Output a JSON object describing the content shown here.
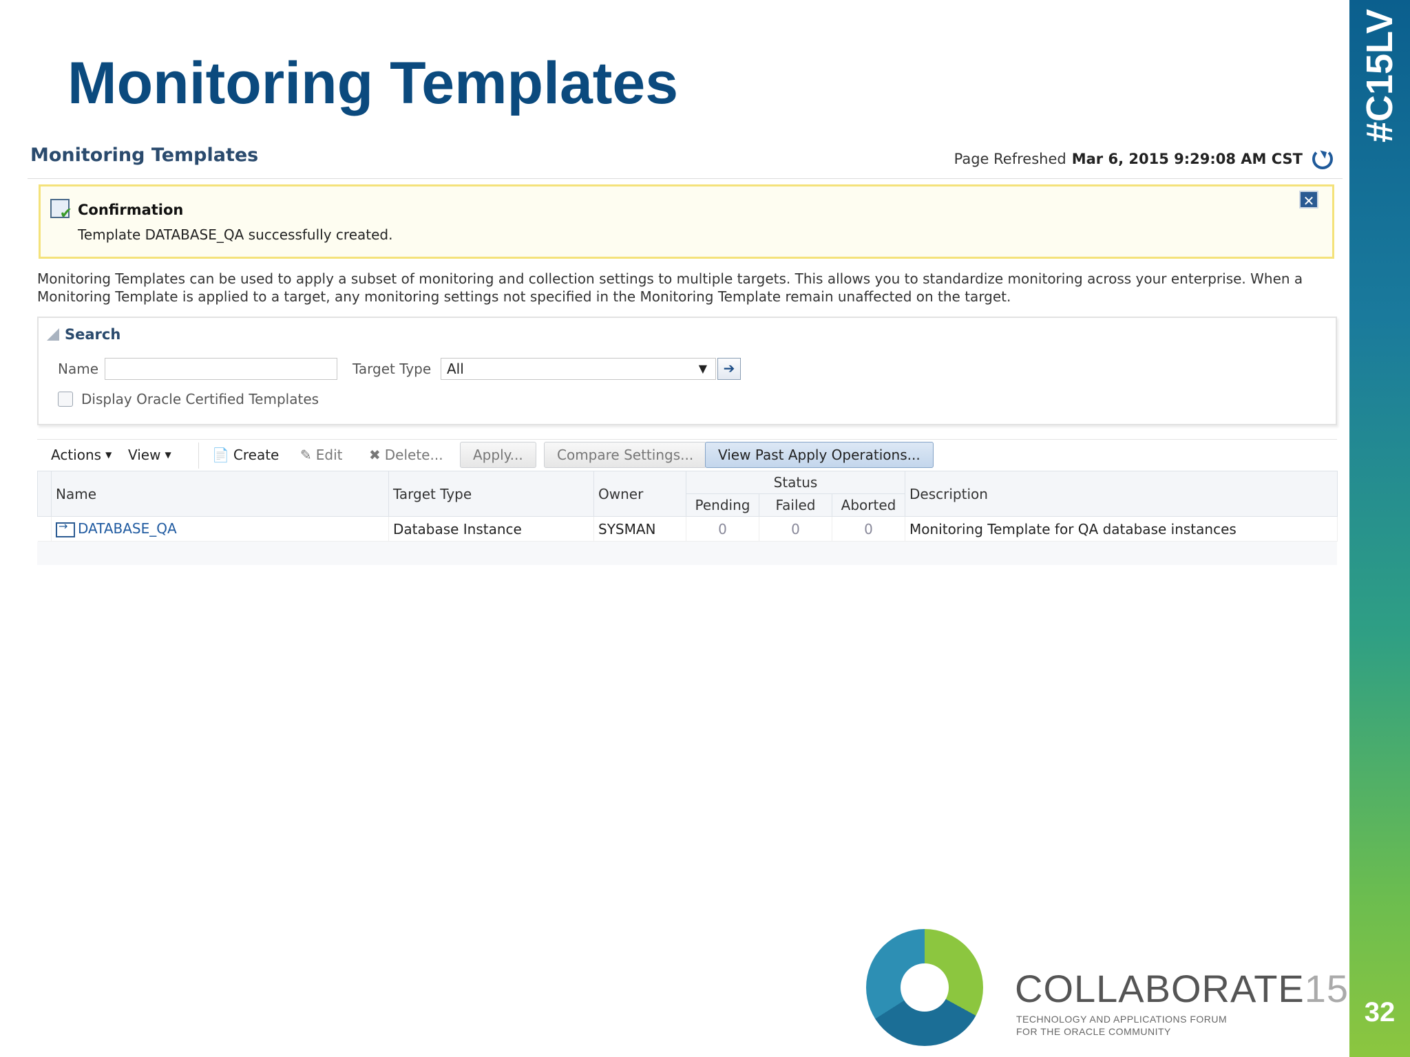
{
  "slide": {
    "title": "Monitoring Templates",
    "hashtag": "#C15LV",
    "page_number": "32"
  },
  "header": {
    "title": "Monitoring Templates",
    "refreshed_label": "Page Refreshed",
    "refreshed_time": "Mar 6, 2015 9:29:08 AM CST"
  },
  "confirmation": {
    "title": "Confirmation",
    "message": "Template DATABASE_QA successfully created."
  },
  "description": "Monitoring Templates can be used to apply a subset of monitoring and collection settings to multiple targets. This allows you to standardize monitoring across your enterprise. When a Monitoring Template is applied to a target, any monitoring settings not specified in the Monitoring Template remain unaffected on the target.",
  "search": {
    "title": "Search",
    "name_label": "Name",
    "name_value": "",
    "target_type_label": "Target Type",
    "target_type_value": "All",
    "certified_label": "Display Oracle Certified Templates"
  },
  "toolbar": {
    "actions": "Actions",
    "view": "View",
    "create": "Create",
    "edit": "Edit",
    "delete": "Delete...",
    "apply": "Apply...",
    "compare": "Compare Settings...",
    "view_past": "View Past Apply Operations..."
  },
  "table": {
    "headers": {
      "name": "Name",
      "target_type": "Target Type",
      "owner": "Owner",
      "status": "Status",
      "pending": "Pending",
      "failed": "Failed",
      "aborted": "Aborted",
      "description": "Description"
    },
    "rows": [
      {
        "name": "DATABASE_QA",
        "target_type": "Database Instance",
        "owner": "SYSMAN",
        "pending": "0",
        "failed": "0",
        "aborted": "0",
        "description": "Monitoring Template for QA database instances"
      }
    ]
  },
  "logo": {
    "name": "COLLABORATE",
    "number": "15",
    "tagline_1": "TECHNOLOGY AND APPLICATIONS FORUM",
    "tagline_2": "FOR THE ORACLE COMMUNITY"
  },
  "colors": {
    "title_blue": "#0b4a7e",
    "sidebar_top": "#0b5f8e",
    "sidebar_bottom": "#8cc63f",
    "confirm_border": "#f4e27a"
  }
}
